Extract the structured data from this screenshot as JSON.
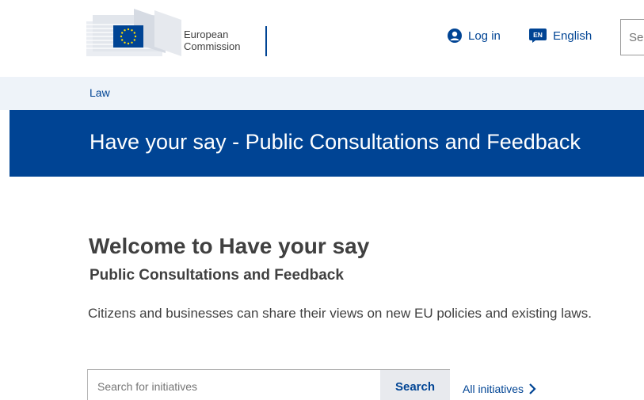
{
  "header": {
    "logo_line1": "European",
    "logo_line2": "Commission",
    "login_label": "Log in",
    "language_code": "EN",
    "language_label": "English",
    "search_placeholder": "Search"
  },
  "breadcrumb": {
    "item": "Law"
  },
  "banner": {
    "title": "Have your say - Public Consultations and Feedback"
  },
  "main": {
    "welcome_title": "Welcome to Have your say",
    "subtitle": "Public Consultations and Feedback",
    "intro": "Citizens and businesses can share their views on new EU policies and existing laws.",
    "search_placeholder": "Search for initiatives",
    "search_button": "Search",
    "all_initiatives": "All initiatives"
  },
  "colors": {
    "brand_blue": "#004494",
    "breadcrumb_bg": "#eef3f9",
    "eu_yellow": "#ffdd00"
  }
}
